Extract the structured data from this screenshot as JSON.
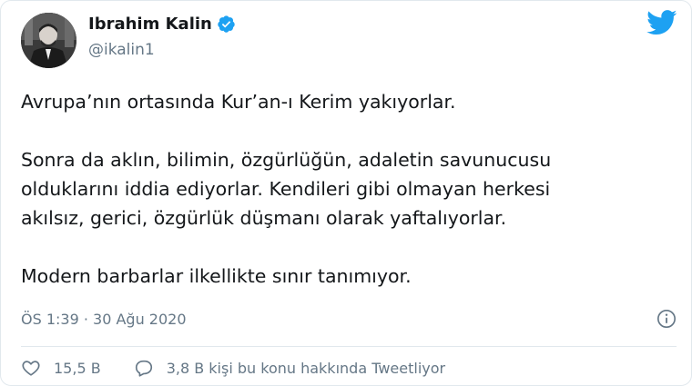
{
  "author": {
    "name": "Ibrahim Kalin",
    "handle": "@ikalin1",
    "verified": true
  },
  "tweet": {
    "paragraphs": [
      "Avrupa’nın ortasında Kur’an-ı Kerim yakıyorlar.",
      "Sonra da aklın, bilimin, özgürlüğün, adaletin savunucusu\nolduklarını iddia ediyorlar. Kendileri gibi olmayan herkesi\nakılsız, gerici, özgürlük düşmanı olarak yaftalıyorlar.",
      "Modern barbarlar ilkellikte sınır tanımıyor."
    ],
    "timestamp": "ÖS 1:39 · 30 Ağu 2020"
  },
  "actions": {
    "like_count": "15,5 B",
    "reply_text": "3,8 B kişi bu konu hakkında Tweetliyor"
  },
  "icons": {
    "verified": "verified-badge-icon",
    "brand": "twitter-bird-icon",
    "info": "info-icon",
    "like": "heart-icon",
    "reply": "reply-bubble-icon"
  },
  "colors": {
    "brand_blue": "#1da1f2",
    "text_primary": "#14171a",
    "text_secondary": "#657786",
    "border": "#e1e8ed"
  }
}
